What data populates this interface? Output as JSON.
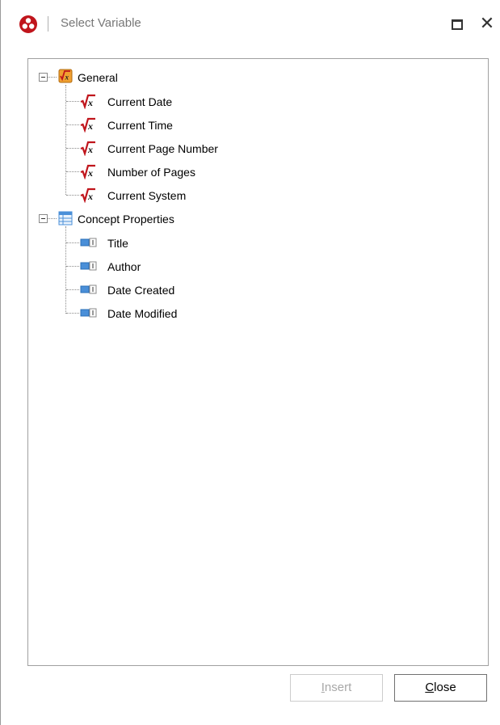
{
  "window": {
    "title": "Select Variable"
  },
  "tree": {
    "groups": [
      {
        "label": "General",
        "icon": "function-group-icon",
        "items": [
          {
            "label": "Current Date",
            "icon": "sqrt-x-icon"
          },
          {
            "label": "Current Time",
            "icon": "sqrt-x-icon"
          },
          {
            "label": "Current Page Number",
            "icon": "sqrt-x-icon"
          },
          {
            "label": "Number of Pages",
            "icon": "sqrt-x-icon"
          },
          {
            "label": "Current System",
            "icon": "sqrt-x-icon"
          }
        ]
      },
      {
        "label": "Concept Properties",
        "icon": "table-icon",
        "items": [
          {
            "label": "Title",
            "icon": "property-field-icon"
          },
          {
            "label": "Author",
            "icon": "property-field-icon"
          },
          {
            "label": "Date Created",
            "icon": "property-field-icon"
          },
          {
            "label": "Date Modified",
            "icon": "property-field-icon"
          }
        ]
      }
    ]
  },
  "buttons": {
    "insert": {
      "mnemonic": "I",
      "rest": "nsert",
      "enabled": false
    },
    "close": {
      "mnemonic": "C",
      "rest": "lose",
      "enabled": true
    }
  },
  "colors": {
    "accent_red": "#c0151c",
    "icon_orange": "#f0a030",
    "icon_blue": "#4a8fd8"
  }
}
